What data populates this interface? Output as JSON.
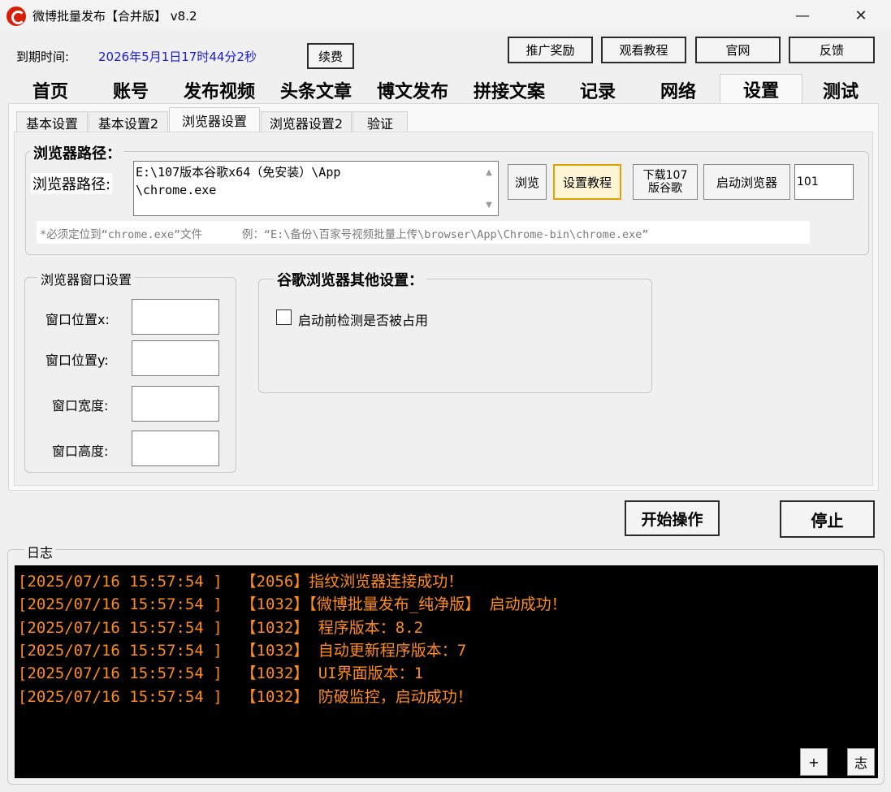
{
  "window": {
    "title": "微博批量发布【合并版】  v8.2",
    "minimize": "—",
    "maximize": "☐",
    "close": "✕"
  },
  "topbar": {
    "expire_label": "到期时间:",
    "expire_value": "2026年5月1日17时44分2秒",
    "renew_button": "续费",
    "buttons": [
      "推广奖励",
      "观看教程",
      "官网",
      "反馈"
    ]
  },
  "main_tabs": [
    "首页",
    "账号",
    "发布视频",
    "头条文章",
    "博文发布",
    "拼接文案",
    "记录",
    "网络",
    "设置",
    "测试"
  ],
  "main_tab_active": "设置",
  "sub_tabs": [
    "基本设置",
    "基本设置2",
    "浏览器设置",
    "浏览器设置2",
    "验证"
  ],
  "sub_tab_active": "浏览器设置",
  "browser_path": {
    "group_title": "浏览器路径：",
    "label": "浏览器路径:",
    "value": "E:\\107版本谷歌x64（免安装）\\App\n\\chrome.exe",
    "browse_button": "浏览",
    "tutorial_button": "设置教程",
    "download_button_line1": "下载107",
    "download_button_line2": "版谷歌",
    "launch_button": "启动浏览器",
    "port_value": "101",
    "hint": "*必须定位到“chrome.exe”文件      例：“E:\\备份\\百家号视频批量上传\\browser\\App\\Chrome-bin\\chrome.exe”"
  },
  "window_settings": {
    "group_title": "浏览器窗口设置",
    "pos_x_label": "窗口位置x:",
    "pos_y_label": "窗口位置y:",
    "width_label": "窗口宽度:",
    "height_label": "窗口高度:",
    "pos_x": "",
    "pos_y": "",
    "width": "",
    "height": ""
  },
  "chrome_other": {
    "group_title": "谷歌浏览器其他设置：",
    "check_occupied_label": "启动前检测是否被占用",
    "check_occupied": false
  },
  "actions": {
    "start": "开始操作",
    "stop": "停止"
  },
  "log": {
    "title": "日志",
    "lines": [
      "[2025/07/16 15:57:54 ]  【2056】指纹浏览器连接成功！",
      "[2025/07/16 15:57:54 ]  【1032】【微博批量发布_纯净版】 启动成功！",
      "[2025/07/16 15:57:54 ]  【1032】 程序版本：8.2",
      "[2025/07/16 15:57:54 ]  【1032】 自动更新程序版本：7",
      "[2025/07/16 15:57:54 ]  【1032】 UI界面版本：1",
      "[2025/07/16 15:57:54 ]  【1032】 防破监控，启动成功！"
    ],
    "plus_button": "+",
    "log_button": "志"
  },
  "colors": {
    "log_text": "#ff8c1a",
    "log_bg": "#000000",
    "expire_value": "#1a1ad8",
    "app_icon": "#d81e06"
  }
}
